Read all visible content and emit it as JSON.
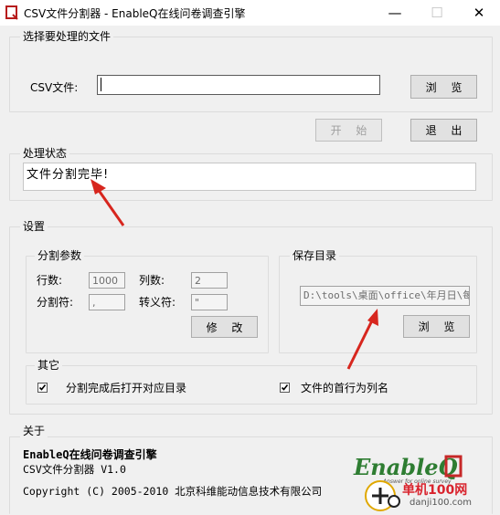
{
  "window": {
    "title": "CSV文件分割器 - EnableQ在线问卷调查引擎",
    "minimize": "—",
    "maximize": "☐",
    "close": "✕"
  },
  "select_file": {
    "group_label": "选择要处理的文件",
    "csv_label": "CSV文件:",
    "csv_value": "",
    "browse_label": "浏 览"
  },
  "actions": {
    "start_label": "开 始",
    "exit_label": "退 出"
  },
  "status": {
    "group_label": "处理状态",
    "text": "文件分割完毕!"
  },
  "settings": {
    "group_label": "设置",
    "split_params": {
      "group_label": "分割参数",
      "rows_label": "行数:",
      "rows_value": "1000",
      "cols_label": "列数:",
      "cols_value": "2",
      "delimiter_label": "分割符:",
      "delimiter_value": ",",
      "escape_label": "转义符:",
      "escape_value": "\"",
      "modify_label": "修 改"
    },
    "save_dir": {
      "group_label": "保存目录",
      "path_value": "D:\\tools\\桌面\\office\\年月日\\每",
      "browse_label": "浏 览"
    },
    "other": {
      "group_label": "其它",
      "open_dir_label": "分割完成后打开对应目录",
      "open_dir_checked": true,
      "first_row_label": "文件的首行为列名",
      "first_row_checked": true
    }
  },
  "about": {
    "group_label": "关于",
    "product": "EnableQ在线问卷调查引擎",
    "version_line": "CSV文件分割器  V1.0",
    "copyright": "Copyright (C) 2005-2010 北京科维能动信息技术有限公司",
    "logo_text": "EnableQ",
    "logo_tagline": "Answer for online survey"
  },
  "watermark": {
    "site_name": "单机100网",
    "site_url": "danji100.com"
  },
  "colors": {
    "arrow": "#d7261e",
    "logo_green": "#2e7d32",
    "logo_red": "#c62828"
  }
}
